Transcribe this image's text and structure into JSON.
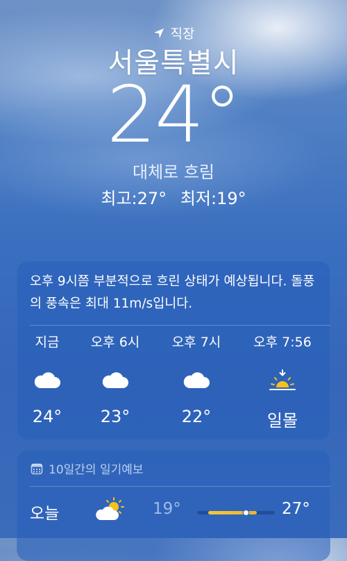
{
  "header": {
    "location_label": "직장",
    "city": "서울특별시",
    "temperature": "24°",
    "condition": "대체로 흐림",
    "high": "최고:27°",
    "low": "최저:19°"
  },
  "hourly": {
    "summary": "오후 9시쯤 부분적으로 흐린 상태가 예상됩니다. 돌풍의 풍속은 최대 11m/s입니다.",
    "items": [
      {
        "label": "지금",
        "icon": "cloud-icon",
        "value": "24°"
      },
      {
        "label": "오후 6시",
        "icon": "cloud-icon",
        "value": "23°"
      },
      {
        "label": "오후 7시",
        "icon": "cloud-icon",
        "value": "22°"
      },
      {
        "label": "오후 7:56",
        "icon": "sunset-icon",
        "value": "일몰"
      }
    ]
  },
  "daily": {
    "header": "10일간의 일기예보",
    "rows": [
      {
        "day": "오늘",
        "icon": "partly-cloudy-icon",
        "low": "19°",
        "high": "27°",
        "current_temp_fraction": 0.625
      }
    ]
  },
  "colors": {
    "sun_yellow": "#f5c21b",
    "bar_yellow": "#f0c93a",
    "card_bg": "rgba(40,95,185,0.55)"
  }
}
